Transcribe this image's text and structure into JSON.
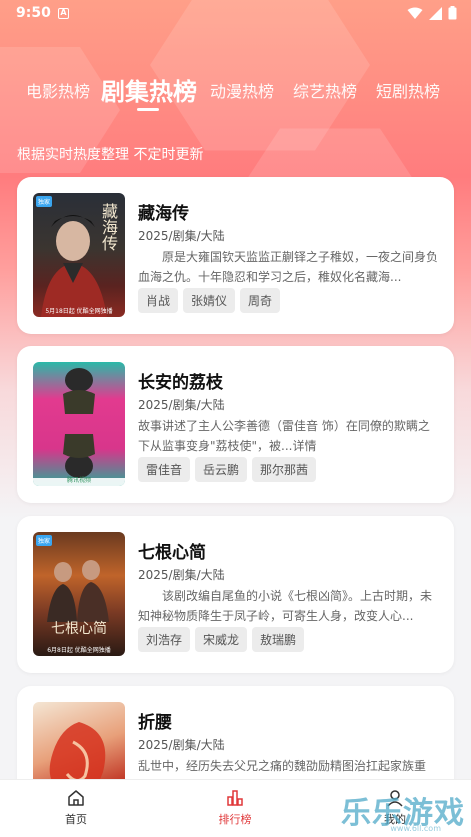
{
  "status_bar": {
    "time": "9:50",
    "notification_icon": "A"
  },
  "tabs": [
    {
      "label": "电影热榜",
      "active": false
    },
    {
      "label": "剧集热榜",
      "active": true
    },
    {
      "label": "动漫热榜",
      "active": false
    },
    {
      "label": "综艺热榜",
      "active": false
    },
    {
      "label": "短剧热榜",
      "active": false
    }
  ],
  "subtitle": "根据实时热度整理 不定时更新",
  "cards": [
    {
      "title": "藏海传",
      "meta": "2025/剧集/大陆",
      "desc": "原是大雍国钦天监监正蒯铎之子稚奴，一夜之间身负血海之仇。十年隐忍和学习之后，稚奴化名藏海...",
      "actors": [
        "肖战",
        "张婧仪",
        "周奇"
      ],
      "poster": {
        "tag": "独家",
        "title": "藏海传",
        "bottom": "5月18日起 优酷全网独播"
      }
    },
    {
      "title": "长安的荔枝",
      "meta": "2025/剧集/大陆",
      "desc": "故事讲述了主人公李善德（雷佳音 饰）在同僚的欺瞒之下从监事变身\"荔枝使\"，被...详情",
      "actors": [
        "雷佳音",
        "岳云鹏",
        "那尔那茜"
      ],
      "poster": {
        "tag": "",
        "title": "",
        "bottom": "腾讯视频"
      }
    },
    {
      "title": "七根心简",
      "meta": "2025/剧集/大陆",
      "desc": "该剧改编自尾鱼的小说《七根凶简》。上古时期，未知神秘物质降生于凤子岭，可寄生人身，改变人心...",
      "actors": [
        "刘浩存",
        "宋威龙",
        "敖瑞鹏"
      ],
      "poster": {
        "tag": "独家",
        "title": "七根心简",
        "bottom": "6月8日起 优酷全网独播"
      }
    },
    {
      "title": "折腰",
      "meta": "2025/剧集/大陆",
      "desc": "乱世中，经历失去父兄之痛的魏劭励精图治扛起家族重任，当他带领魏家一雪前耻之际，却发现...",
      "actors": [],
      "poster": {
        "tag": "",
        "title": "",
        "bottom": ""
      }
    }
  ],
  "bottom_nav": [
    {
      "label": "首页",
      "icon": "home-icon",
      "active": false
    },
    {
      "label": "排行榜",
      "icon": "chart-bar-icon",
      "active": true
    },
    {
      "label": "我的",
      "icon": "user-icon",
      "active": false
    }
  ],
  "watermark": {
    "text": "乐乐游戏",
    "sub": "www.6ll.com"
  },
  "colors": {
    "accent": "#e0383a",
    "header_top": "#ff9f88",
    "header_mid": "#ff7c7e",
    "chip_bg": "#ececec"
  }
}
